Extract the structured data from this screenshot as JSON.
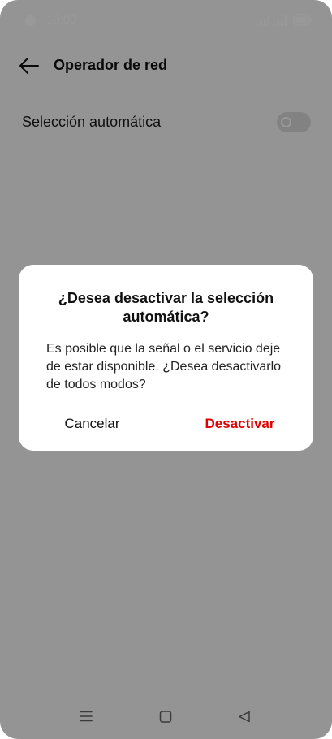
{
  "status_bar": {
    "time": "10:00"
  },
  "header": {
    "title": "Operador de red",
    "back_icon": "arrow-left-icon"
  },
  "settings": {
    "auto_selection": {
      "label": "Selección automática",
      "enabled": false
    }
  },
  "dialog": {
    "title": "¿Desea desactivar la selección automática?",
    "message": "Es posible que la señal o el servicio deje de estar disponible. ¿Desea desactivarlo de todos modos?",
    "cancel_label": "Cancelar",
    "confirm_label": "Desactivar"
  },
  "nav_bar": {
    "icons": [
      "menu-icon",
      "home-icon",
      "back-icon"
    ]
  },
  "colors": {
    "accent_destructive": "#e00000",
    "overlay": "#000000"
  }
}
